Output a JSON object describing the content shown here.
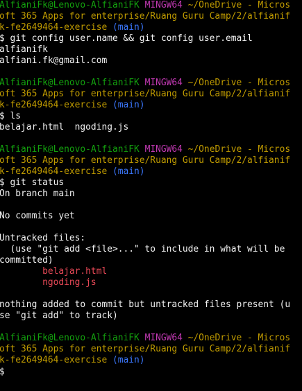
{
  "blocks": [
    {
      "prompt": {
        "user": "AlfianiFk@Lenovo-AlfianiFK",
        "env": "MINGW64",
        "path_lines": [
          " ~/OneDrive - Micros",
          "oft 365 Apps for enterprise/Ruang Guru Camp/2/alfianif",
          "k-fe2649464-exercise"
        ],
        "branch": "(main)"
      },
      "command": "$ git config user.name && git config user.email",
      "output": [
        "alfianifk",
        "alfiani.fk@gmail.com"
      ]
    },
    {
      "prompt": {
        "user": "AlfianiFk@Lenovo-AlfianiFK",
        "env": "MINGW64",
        "path_lines": [
          " ~/OneDrive - Micros",
          "oft 365 Apps for enterprise/Ruang Guru Camp/2/alfianif",
          "k-fe2649464-exercise"
        ],
        "branch": "(main)"
      },
      "command": "$ ls",
      "output": [
        "belajar.html  ngoding.js"
      ]
    },
    {
      "prompt": {
        "user": "AlfianiFk@Lenovo-AlfianiFK",
        "env": "MINGW64",
        "path_lines": [
          " ~/OneDrive - Micros",
          "oft 365 Apps for enterprise/Ruang Guru Camp/2/alfianif",
          "k-fe2649464-exercise"
        ],
        "branch": "(main)"
      },
      "command": "$ git status",
      "output_status": {
        "branch_line": "On branch main",
        "no_commits": "No commits yet",
        "untracked_header": "Untracked files:",
        "hint_1": "  (use \"git add <file>...\" to include in what will be",
        "hint_2": "committed)",
        "files": [
          "        belajar.html",
          "        ngoding.js"
        ],
        "summary_1": "nothing added to commit but untracked files present (u",
        "summary_2": "se \"git add\" to track)"
      }
    },
    {
      "prompt": {
        "user": "AlfianiFk@Lenovo-AlfianiFK",
        "env": "MINGW64",
        "path_lines": [
          " ~/OneDrive - Micros",
          "oft 365 Apps for enterprise/Ruang Guru Camp/2/alfianif",
          "k-fe2649464-exercise"
        ],
        "branch": "(main)"
      },
      "command": "$"
    }
  ],
  "colors": {
    "background": "#000000",
    "user": "#13a10e",
    "env": "#c239b3",
    "path": "#c19c00",
    "branch": "#3b78ff",
    "untracked": "#e74856",
    "text": "#f2f2f2"
  }
}
